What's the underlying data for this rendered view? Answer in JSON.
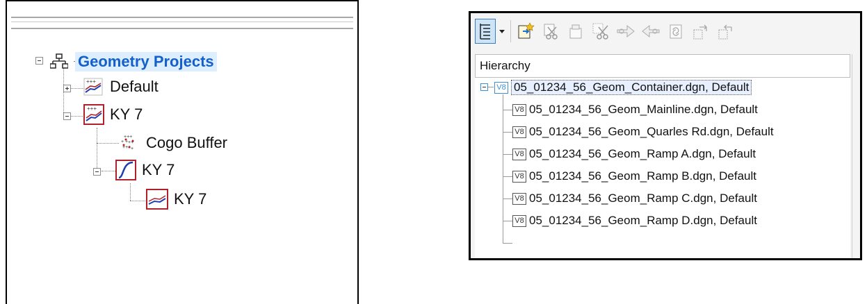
{
  "left_tree": {
    "root": {
      "label": "Geometry Projects",
      "icon": "hierarchy-icon",
      "expanded": true
    },
    "nodes": [
      {
        "label": "Default",
        "icon": "geometry-project-icon",
        "expanded": false
      },
      {
        "label": "KY 7",
        "icon": "geometry-project-icon",
        "expanded": true
      },
      {
        "label": "Cogo Buffer",
        "icon": "cogo-points-icon"
      },
      {
        "label": "KY 7",
        "icon": "alignment-icon",
        "expanded": true
      },
      {
        "label": "KY 7",
        "icon": "profile-icon"
      }
    ]
  },
  "right_panel": {
    "toolbar": {
      "buttons": [
        "hierarchy-view-icon",
        "dropdown-arrow-icon",
        "attach-reference-icon",
        "detach-icon",
        "reload-icon",
        "cut-clip-icon",
        "move-forward-icon",
        "move-backward-icon",
        "copy-icon",
        "export-icon",
        "import-icon"
      ]
    },
    "header": "Hierarchy",
    "files": [
      {
        "badge": "V8",
        "label": "05_01234_56_Geom_Container.dgn, Default",
        "selected": true
      },
      {
        "badge": "V8",
        "label": "05_01234_56_Geom_Mainline.dgn, Default"
      },
      {
        "badge": "V8",
        "label": "05_01234_56_Geom_Quarles Rd.dgn, Default"
      },
      {
        "badge": "V8",
        "label": "05_01234_56_Geom_Ramp A.dgn, Default"
      },
      {
        "badge": "V8",
        "label": "05_01234_56_Geom_Ramp B.dgn, Default"
      },
      {
        "badge": "V8",
        "label": "05_01234_56_Geom_Ramp C.dgn, Default"
      },
      {
        "badge": "V8",
        "label": "05_01234_56_Geom_Ramp D.dgn, Default"
      }
    ]
  },
  "colors": {
    "selection_blue": "#1560c8",
    "icon_red": "#b0202a",
    "badge_blue": "#3b8ed8"
  }
}
